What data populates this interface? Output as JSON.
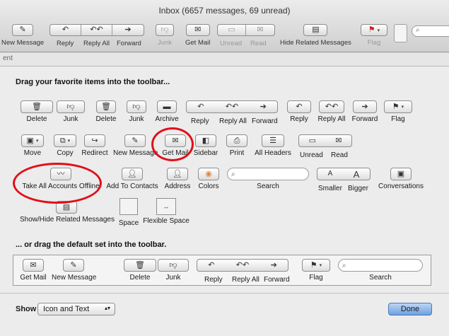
{
  "window": {
    "title": "Inbox (6657 messages, 69 unread)",
    "toolbar": [
      {
        "label": "New Message",
        "icon": "compose-icon"
      },
      {
        "label": "Reply",
        "icon": "reply-icon"
      },
      {
        "label": "Reply All",
        "icon": "reply-all-icon"
      },
      {
        "label": "Forward",
        "icon": "forward-icon"
      },
      {
        "label": "Junk",
        "icon": "junk-icon"
      },
      {
        "label": "Get Mail",
        "icon": "envelope-icon"
      },
      {
        "label": "Unread",
        "icon": "unread-icon"
      },
      {
        "label": "Read",
        "icon": "read-icon"
      },
      {
        "label": "Hide Related Messages",
        "icon": "related-icon"
      },
      {
        "label": "Flag",
        "icon": "flag-icon"
      }
    ],
    "background_text": "ent"
  },
  "sheet": {
    "heading_top": "Drag your favorite items into the toolbar...",
    "heading_default": "... or drag the default set into the toolbar.",
    "items": {
      "delete": "Delete",
      "junk": "Junk",
      "delete2": "Delete",
      "junk2": "Junk",
      "archive": "Archive",
      "reply": "Reply",
      "reply_all": "Reply All",
      "forward": "Forward",
      "reply2": "Reply",
      "reply_all2": "Reply All",
      "forward2": "Forward",
      "flag": "Flag",
      "move": "Move",
      "copy": "Copy",
      "redirect": "Redirect",
      "new_message": "New Message",
      "get_mail": "Get Mail",
      "sidebar": "Sidebar",
      "print": "Print",
      "all_headers": "All Headers",
      "unread": "Unread",
      "read": "Read",
      "take_all_accounts_offline": "Take All Accounts Offline",
      "add_to_contacts": "Add To Contacts",
      "address": "Address",
      "colors": "Colors",
      "search": "Search",
      "smaller": "Smaller",
      "bigger": "Bigger",
      "conversations": "Conversations",
      "show_hide_related": "Show/Hide Related Messages",
      "space": "Space",
      "flexible_space": "Flexible Space"
    },
    "default_set": {
      "get_mail": "Get Mail",
      "new_message": "New Message",
      "delete": "Delete",
      "junk": "Junk",
      "reply": "Reply",
      "reply_all": "Reply All",
      "forward": "Forward",
      "flag": "Flag",
      "search": "Search"
    },
    "show": {
      "label": "Show",
      "value": "Icon and Text"
    },
    "done_label": "Done"
  },
  "colors": {
    "highlight_circle": "#e0101a",
    "done_button": "#6fa0e0",
    "flag": "#cc2222"
  }
}
